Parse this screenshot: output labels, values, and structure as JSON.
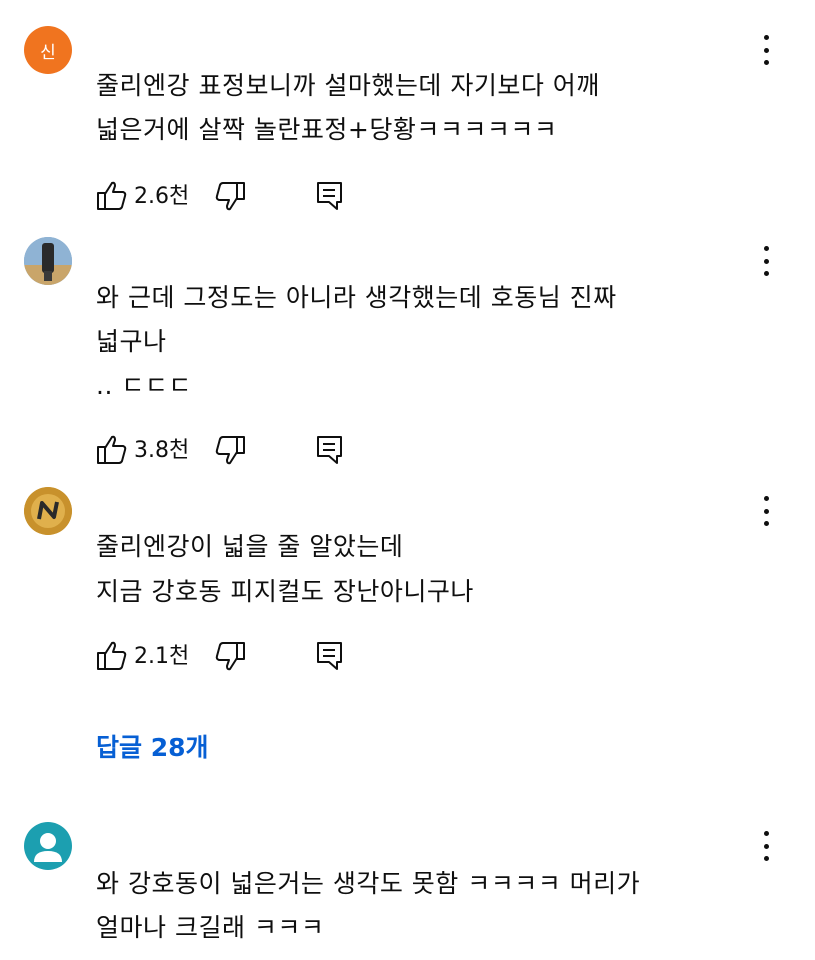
{
  "comments": [
    {
      "avatar_initial": "신",
      "avatar_color": "#f0741f",
      "lines": [
        "줄리엔강 표정보니까 설마했는데 자기보다 어깨",
        "넓은거에 살짝 놀란표정+당황ㅋㅋㅋㅋㅋㅋ"
      ],
      "likes": "2.6천"
    },
    {
      "avatar_initial": "",
      "lines": [
        "와 근데 그정도는 아니라 생각했는데 호동님 진짜",
        "넓구나",
        ".. ㄷㄷㄷ"
      ],
      "likes": "3.8천"
    },
    {
      "avatar_initial": "",
      "lines": [
        "줄리엔강이 넓을 줄 알았는데",
        "지금 강호동 피지컬도 장난아니구나"
      ],
      "likes": "2.1천"
    },
    {
      "avatar_initial": "",
      "lines": [
        "와 강호동이 넓은거는 생각도 못함 ㅋㅋㅋㅋ 머리가",
        "얼마나 크길래 ㅋㅋㅋ"
      ]
    }
  ],
  "replies_label": "답글 28개",
  "colors": {
    "link": "#065fd4",
    "text": "#0f0f0f",
    "default_avatar": "#1c9fb0"
  },
  "icons": [
    "thumbs-up-icon",
    "thumbs-down-icon",
    "reply-icon",
    "more-vert-icon",
    "default-avatar-icon"
  ]
}
